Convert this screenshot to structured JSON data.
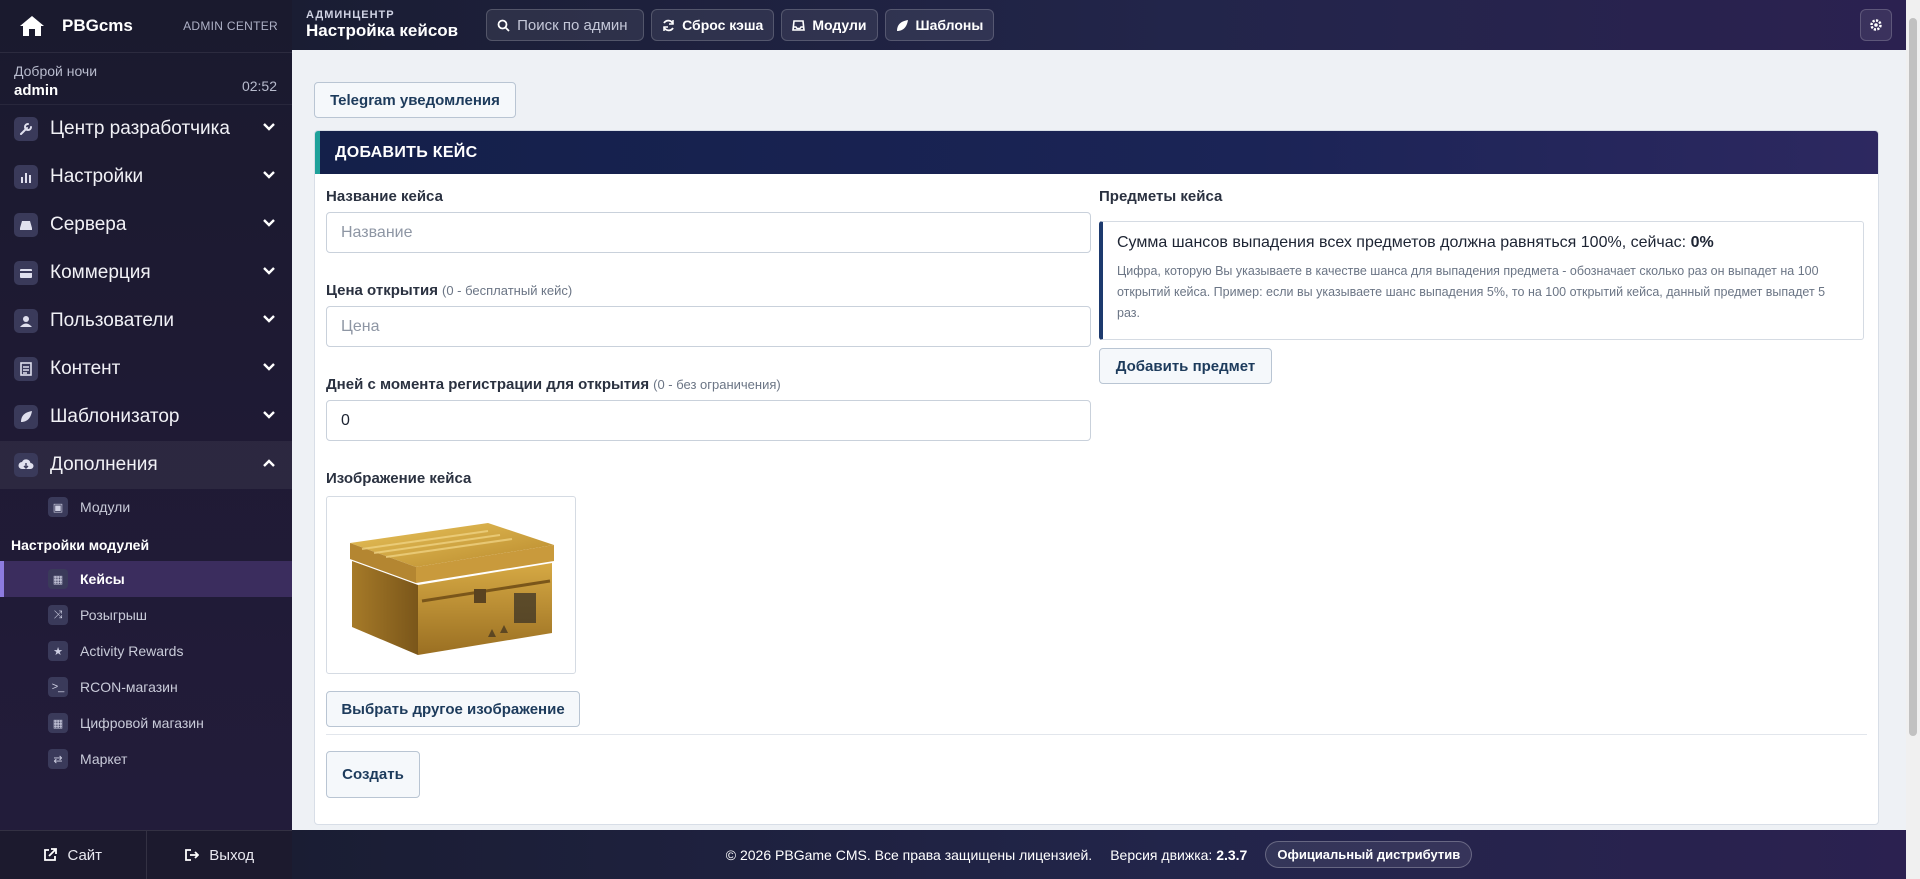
{
  "brand": {
    "name": "PBGcms",
    "subtitle": "ADMIN CENTER"
  },
  "greeting": {
    "line1": "Доброй ночи",
    "user": "admin",
    "time": "02:52"
  },
  "menu": [
    {
      "label": "Центр разработчика",
      "icon": "wrench-icon"
    },
    {
      "label": "Настройки",
      "icon": "sliders-icon"
    },
    {
      "label": "Сервера",
      "icon": "server-icon"
    },
    {
      "label": "Коммерция",
      "icon": "card-icon"
    },
    {
      "label": "Пользователи",
      "icon": "user-icon"
    },
    {
      "label": "Контент",
      "icon": "document-icon"
    },
    {
      "label": "Шаблонизатор",
      "icon": "leaf-icon"
    },
    {
      "label": "Дополнения",
      "icon": "cloud-download-icon"
    }
  ],
  "submenu": {
    "modules": "Модули"
  },
  "module_settings": {
    "title": "Настройки модулей",
    "items": [
      {
        "label": "Кейсы",
        "icon": "grid-icon"
      },
      {
        "label": "Розыгрыш",
        "icon": "shuffle-icon"
      },
      {
        "label": "Activity Rewards",
        "icon": "star-icon"
      },
      {
        "label": "RCON-магазин",
        "icon": "terminal-icon"
      },
      {
        "label": "Цифровой магазин",
        "icon": "grid-icon"
      },
      {
        "label": "Маркет",
        "icon": "exchange-icon"
      }
    ]
  },
  "sidebar_bottom": {
    "site": "Сайт",
    "logout": "Выход"
  },
  "topbar": {
    "crumb_top": "АДМИНЦЕНТР",
    "crumb_title": "Настройка кейсов",
    "search_placeholder": "Поиск по админ",
    "btn_cache": "Сброс кэша",
    "btn_modules": "Модули",
    "btn_templates": "Шаблоны"
  },
  "telegram_button": "Telegram уведомления",
  "form": {
    "header": "ДОБАВИТЬ КЕЙС",
    "name_label": "Название кейса",
    "name_placeholder": "Название",
    "price_label": "Цена открытия",
    "price_hint": "(0 - бесплатный кейс)",
    "price_placeholder": "Цена",
    "days_label": "Дней с момента регистрации для открытия",
    "days_hint": "(0 - без ограничения)",
    "days_value": "0",
    "image_label": "Изображение кейса",
    "image_button": "Выбрать другое изображение",
    "submit": "Создать"
  },
  "items_panel": {
    "title": "Предметы кейса",
    "sum_text": "Сумма шансов выпадения всех предметов должна равняться 100%, сейчас:",
    "sum_value": "0%",
    "description": "Цифра, которую Вы указываете в качестве шанса для выпадения предмета - обозначает сколько раз он выпадет на 100 открытий кейса. Пример: если вы указываете шанс выпадения 5%, то на 100 открытий кейса, данный предмет выпадет 5 раз.",
    "add_button": "Добавить предмет"
  },
  "footer": {
    "copyright": "© 2026 PBGame CMS. Все права защищены лицензией.",
    "version_label": "Версия движка:",
    "version": "2.3.7",
    "distributor": "Официальный дистрибутив"
  }
}
